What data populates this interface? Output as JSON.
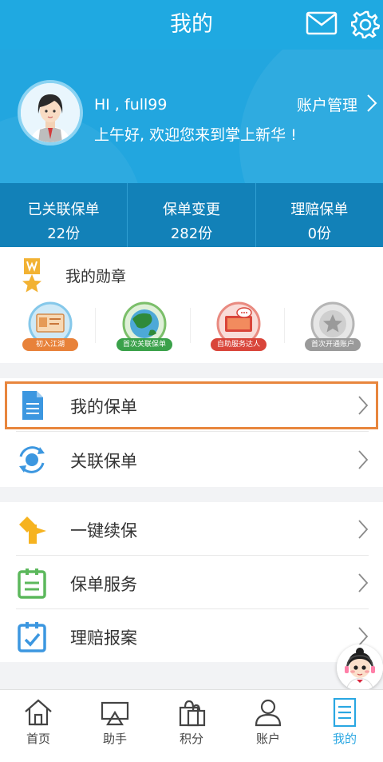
{
  "header": {
    "title": "我的"
  },
  "profile": {
    "greeting_name": "HI , full99",
    "greeting_text": "上午好, 欢迎您来到掌上新华 !",
    "account_management": "账户管理"
  },
  "stats": [
    {
      "label": "已关联保单",
      "value": "22份"
    },
    {
      "label": "保单变更",
      "value": "282份"
    },
    {
      "label": "理赔保单",
      "value": "0份"
    }
  ],
  "medals": {
    "title": "我的勋章",
    "items": [
      {
        "label": "初入江湖",
        "color": "#e8823a"
      },
      {
        "label": "首次关联保单",
        "color": "#3aa14a"
      },
      {
        "label": "自助服务达人",
        "color": "#d9453a"
      },
      {
        "label": "首次开通账户",
        "color": "#9a9a9a"
      }
    ]
  },
  "menu": {
    "my_policies": "我的保单",
    "linked_policies": "关联保单",
    "one_click_renewal": "一键续保",
    "policy_services": "保单服务",
    "claim_report": "理赔报案"
  },
  "tabs": [
    {
      "label": "首页",
      "icon": "home-icon"
    },
    {
      "label": "助手",
      "icon": "assistant-icon"
    },
    {
      "label": "积分",
      "icon": "points-icon"
    },
    {
      "label": "账户",
      "icon": "account-icon"
    },
    {
      "label": "我的",
      "icon": "mine-icon",
      "active": true
    }
  ],
  "colors": {
    "header_blue": "#1fa9e1",
    "stats_blue": "#1281b8",
    "active_tab": "#2aa7e2",
    "highlight": "#e8863d"
  }
}
